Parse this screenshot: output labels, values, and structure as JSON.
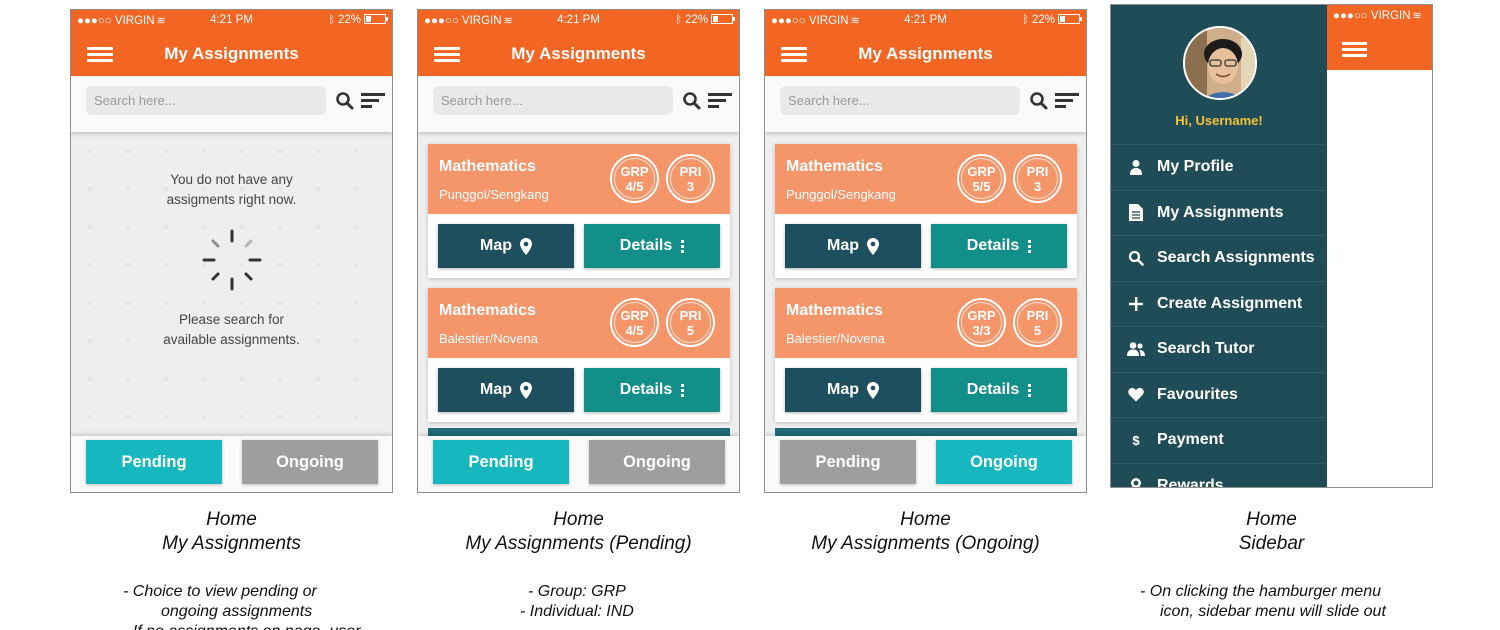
{
  "status_bar": {
    "carrier": "●●●○○ VIRGIN",
    "time": "4:21 PM",
    "battery": "22%"
  },
  "app": {
    "title": "My Assignments",
    "search_placeholder": "Search here..."
  },
  "screen1": {
    "empty_line1": "You do not have any",
    "empty_line2": "assigments right now.",
    "hint_line1": "Please search for",
    "hint_line2": "available assignments.",
    "tabs": {
      "pending": "Pending",
      "ongoing": "Ongoing"
    }
  },
  "screen2": {
    "cards": [
      {
        "subject": "Mathematics",
        "location": "Punggol/Sengkang",
        "grp_label": "GRP",
        "grp_value": "4/5",
        "pri_label": "PRI",
        "pri_value": "3",
        "map": "Map",
        "details": "Details"
      },
      {
        "subject": "Mathematics",
        "location": "Balestier/Novena",
        "grp_label": "GRP",
        "grp_value": "4/5",
        "pri_label": "PRI",
        "pri_value": "5",
        "map": "Map",
        "details": "Details"
      }
    ],
    "tabs": {
      "pending": "Pending",
      "ongoing": "Ongoing"
    }
  },
  "screen3": {
    "cards": [
      {
        "subject": "Mathematics",
        "location": "Punggol/Sengkang",
        "grp_label": "GRP",
        "grp_value": "5/5",
        "pri_label": "PRI",
        "pri_value": "3",
        "map": "Map",
        "details": "Details"
      },
      {
        "subject": "Mathematics",
        "location": "Balestier/Novena",
        "grp_label": "GRP",
        "grp_value": "3/3",
        "pri_label": "PRI",
        "pri_value": "5",
        "map": "Map",
        "details": "Details"
      }
    ],
    "tabs": {
      "pending": "Pending",
      "ongoing": "Ongoing"
    }
  },
  "sidebar": {
    "greeting": "Hi, Username!",
    "carrier": "●●●○○ VIRGIN",
    "items": [
      {
        "label": "My Profile",
        "icon": "person-icon"
      },
      {
        "label": "My Assignments",
        "icon": "document-icon"
      },
      {
        "label": "Search Assignments",
        "icon": "search-icon"
      },
      {
        "label": "Create Assignment",
        "icon": "plus-icon"
      },
      {
        "label": "Search Tutor",
        "icon": "people-icon"
      },
      {
        "label": "Favourites",
        "icon": "heart-icon"
      },
      {
        "label": "Payment",
        "icon": "dollar-icon"
      },
      {
        "label": "Rewards",
        "icon": "ribbon-icon"
      }
    ]
  },
  "captions": {
    "c1_line1": "Home",
    "c1_line2": "My Assignments",
    "c2_line1": "Home",
    "c2_line2": "My Assignments (Pending)",
    "c3_line1": "Home",
    "c3_line2": "My Assignments (Ongoing)",
    "c4_line1": "Home",
    "c4_line2": "Sidebar"
  },
  "notes": {
    "n1_line1": "-  Choice to view pending or",
    "n1_line2": "ongoing assignments",
    "n1_line3": "-  If no assignments on page, user",
    "n2_line1": "-  Group: GRP",
    "n2_line2": "-  Individual: IND",
    "n4_line1": "-  On clicking the hamburger menu",
    "n4_line2": "icon, sidebar menu will slide out"
  },
  "colors": {
    "brand_orange": "#f26522",
    "card_orange": "#f4956a",
    "teal_dark": "#1d4f5e",
    "teal": "#138f8a",
    "tab_active": "#16b7be",
    "tab_inactive": "#9e9e9e",
    "sidebar_bg": "#1f4c56",
    "greeting_yellow": "#f6c23e"
  }
}
